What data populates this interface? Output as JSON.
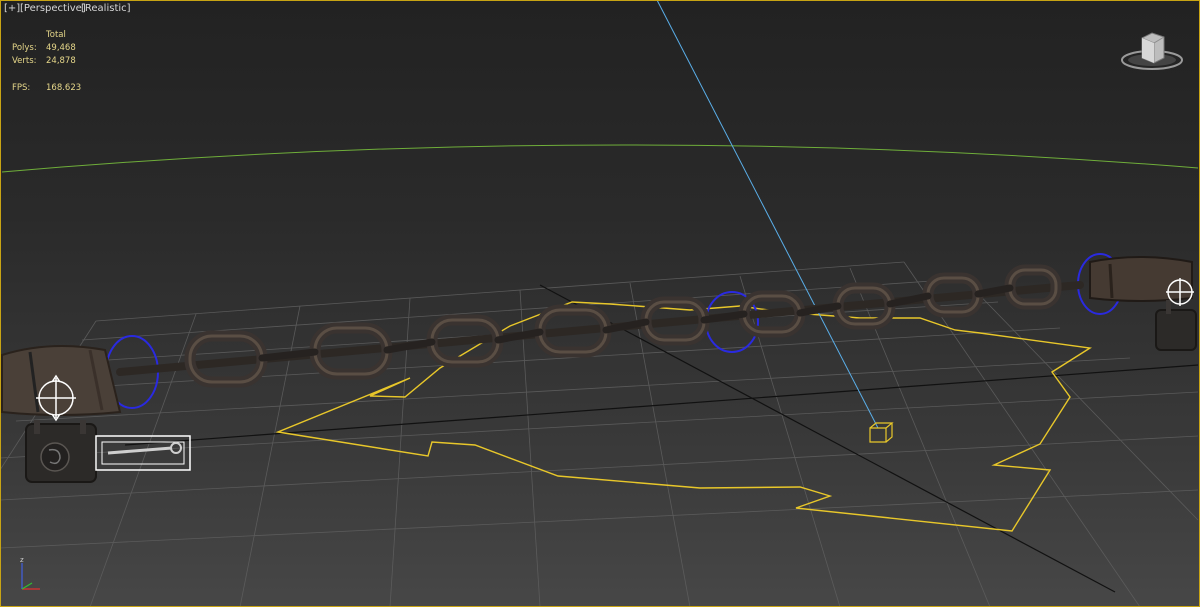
{
  "viewport": {
    "label_plus": "[+]",
    "label_view": "[Perspective]",
    "label_shading": "[Realistic]"
  },
  "stats": {
    "header": "Total",
    "polys_label": "Polys:",
    "polys_value": "49,468",
    "verts_label": "Verts:",
    "verts_value": "24,878",
    "fps_label": "FPS:",
    "fps_value": "168.623"
  },
  "axis_tripod": {
    "z_label": "z"
  },
  "colors": {
    "selection_border": "#c8a414",
    "spline": "#e8c72a",
    "helper_circle": "#2a2ae0",
    "target_line": "#5aaee8",
    "horizon": "#6fae3a",
    "grid": "#5e5e5e",
    "stats_text": "#e6d78a"
  },
  "icons": {
    "viewcube": "viewcube-icon",
    "axis": "axis-tripod-icon",
    "light_target": "light-target-icon",
    "move_gizmo": "move-gizmo-icon"
  }
}
